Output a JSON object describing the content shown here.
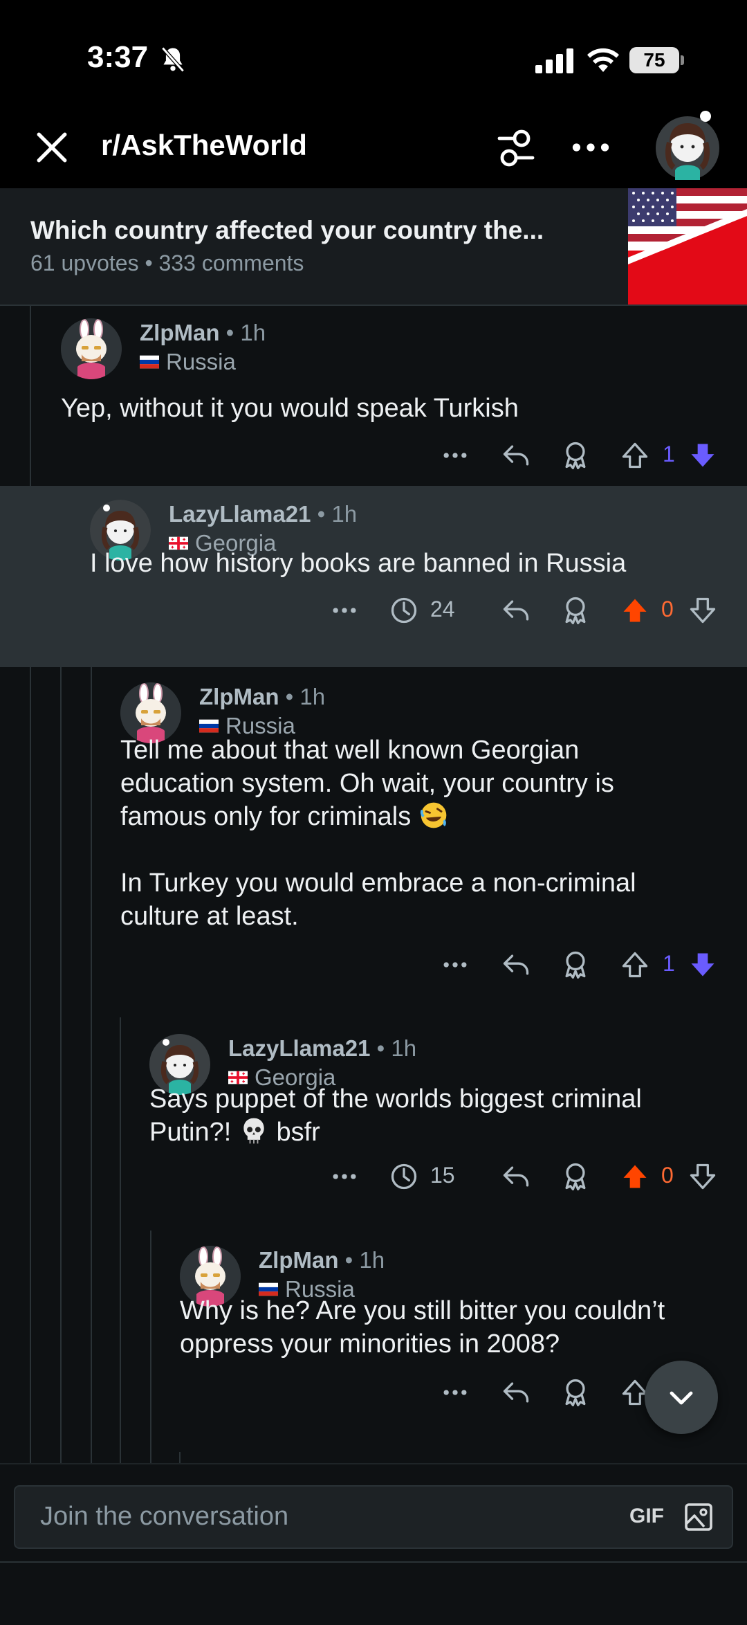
{
  "status": {
    "time": "3:37",
    "battery": "75"
  },
  "nav": {
    "title": "r/AskTheWorld"
  },
  "post": {
    "title": "Which country affected your country the...",
    "meta": "61 upvotes • 333 comments"
  },
  "comments": [
    {
      "user": "ZlpMan",
      "time": "1h",
      "flair": "Russia",
      "text": "Yep, without it you would speak Turkish",
      "score": "1",
      "vote": "down"
    },
    {
      "user": "LazyLlama21",
      "time": "1h",
      "flair": "Georgia",
      "text": "I love how history books are banned in Russia",
      "timer": "24",
      "score": "0",
      "vote": "up"
    },
    {
      "user": "ZlpMan",
      "time": "1h",
      "flair": "Russia",
      "text": "Tell me about that well known Georgian\neducation system. Oh wait, your country is\nfamous only for criminals",
      "text2": "In Turkey you would embrace a non-criminal\nculture at least.",
      "score": "1",
      "vote": "down"
    },
    {
      "user": "LazyLlama21",
      "time": "1h",
      "flair": "Georgia",
      "text": "Says puppet of the worlds biggest criminal\nPutin?!",
      "text_tail": "bsfr",
      "timer": "15",
      "score": "0",
      "vote": "up"
    },
    {
      "user": "ZlpMan",
      "time": "1h",
      "flair": "Russia",
      "text": "Why is he? Are you still bitter you couldn’t\noppress your minorities in 2008?",
      "vote": "down"
    }
  ],
  "composer": {
    "placeholder": "Join the conversation",
    "gif": "GIF"
  },
  "colors": {
    "upvote": "#ff4500",
    "downvote": "#6a5cff",
    "background": "#0e1113",
    "highlight": "#2b3236"
  },
  "icons": [
    "close-icon",
    "filter-icon",
    "more-icon",
    "reply-icon",
    "award-icon",
    "upvote-icon",
    "downvote-icon",
    "timer-icon",
    "chevron-down-icon",
    "image-icon"
  ]
}
